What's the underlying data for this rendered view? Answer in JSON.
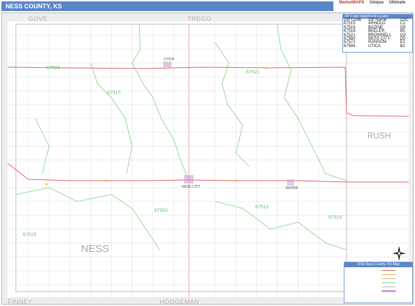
{
  "title": "NESS COUNTY, KS",
  "brand": [
    "MarketMAPS",
    "Unique",
    "Ultimate"
  ],
  "neighbors": {
    "gove": "GOVE",
    "trego": "TREGO",
    "rush": "RUSH",
    "finney": "FINNEY",
    "hodgeman": "HODGEMAN"
  },
  "county_label": "NESS",
  "zip_labels": [
    "67584",
    "67515",
    "67521",
    "67560",
    "67516",
    "67518",
    "67516"
  ],
  "town_labels": [
    "UTICA",
    "NESS CITY",
    "BAZINE"
  ],
  "legend": {
    "header": "ZIP Code Index/Grid Locator",
    "columns": [
      "ZIP Code",
      "ZIP Name",
      "LOC"
    ],
    "rows": [
      [
        "67515",
        "ARNOLD",
        "C2"
      ],
      [
        "67516",
        "BAZINE",
        "G5"
      ],
      [
        "67518",
        "BEELER",
        "B5"
      ],
      [
        "67521",
        "BROWNELL",
        "G3"
      ],
      [
        "67560",
        "NESS CITY",
        "D5"
      ],
      [
        "67572",
        "RANSOM",
        "E2"
      ],
      [
        "67584",
        "UTICA",
        "B2"
      ]
    ]
  },
  "map_key": {
    "title": "2016 Ness County, KS Map"
  },
  "colors": {
    "title_bar": "#5b86c9",
    "zip_boundary": "#7fd07f",
    "highway": "#e06060",
    "major_road": "#f0b030"
  }
}
